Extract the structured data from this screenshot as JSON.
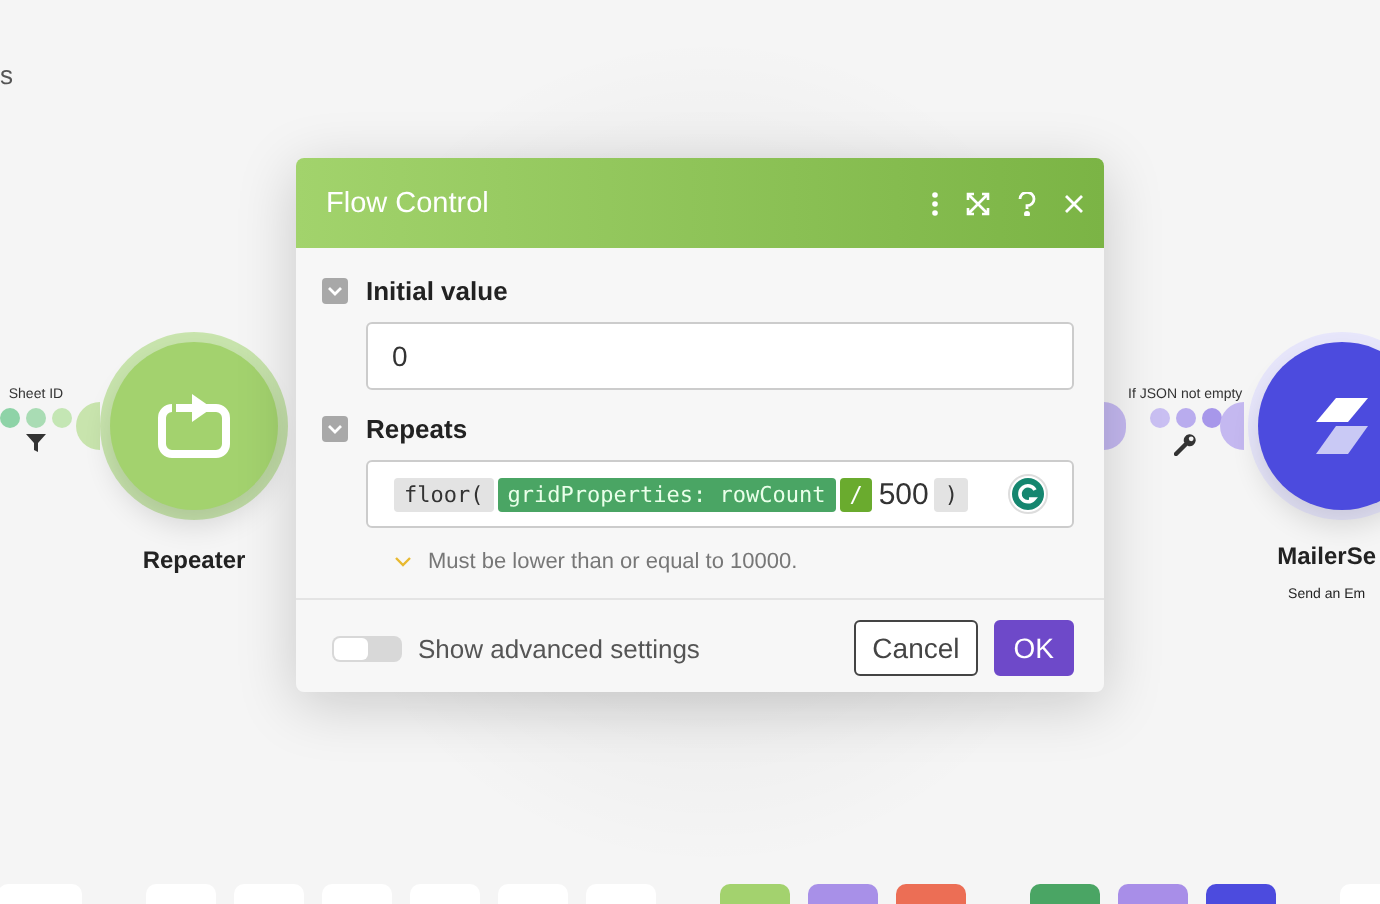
{
  "canvas": {
    "corner_text": "s"
  },
  "nodes": [
    {
      "kind": "repeater",
      "title": "Repeater"
    },
    {
      "kind": "mailer",
      "title": "MailerSe",
      "subtitle": "Send an Em"
    }
  ],
  "links": [
    {
      "kind": "filter",
      "label": "Sheet ID"
    },
    {
      "kind": "wrench",
      "label": "If JSON not empty"
    }
  ],
  "modal": {
    "title": "Flow Control",
    "fields": [
      {
        "kind": "text",
        "label": "Initial value",
        "expanded": true,
        "value": "0"
      },
      {
        "kind": "expression",
        "label": "Repeats",
        "expanded": true,
        "tokens": [
          {
            "kind": "function",
            "text": "floor("
          },
          {
            "kind": "variable",
            "text": "gridProperties: rowCount"
          },
          {
            "kind": "operator",
            "text": "/"
          },
          {
            "kind": "plain",
            "text": "500"
          },
          {
            "kind": "function",
            "text": ")"
          }
        ],
        "hint": "Must be lower than or equal to 10000."
      }
    ],
    "advanced": {
      "label": "Show advanced settings",
      "on": false
    },
    "buttons": [
      {
        "kind": "secondary",
        "label": "Cancel"
      },
      {
        "kind": "primary",
        "label": "OK"
      }
    ]
  },
  "toolbar": [
    [
      {
        "color": "#ffffff"
      }
    ],
    [
      {
        "color": "#ffffff"
      },
      {
        "color": "#ffffff"
      },
      {
        "color": "#ffffff"
      },
      {
        "color": "#ffffff"
      },
      {
        "color": "#ffffff"
      },
      {
        "color": "#ffffff"
      }
    ],
    [
      {
        "color": "#a3d26e"
      },
      {
        "color": "#a890e8"
      },
      {
        "color": "#ec6e55"
      }
    ],
    [
      {
        "color": "#4aa564"
      },
      {
        "color": "#a88ee8"
      },
      {
        "color": "#4c4bde"
      }
    ],
    [
      {
        "color": "#ffffff"
      }
    ]
  ]
}
